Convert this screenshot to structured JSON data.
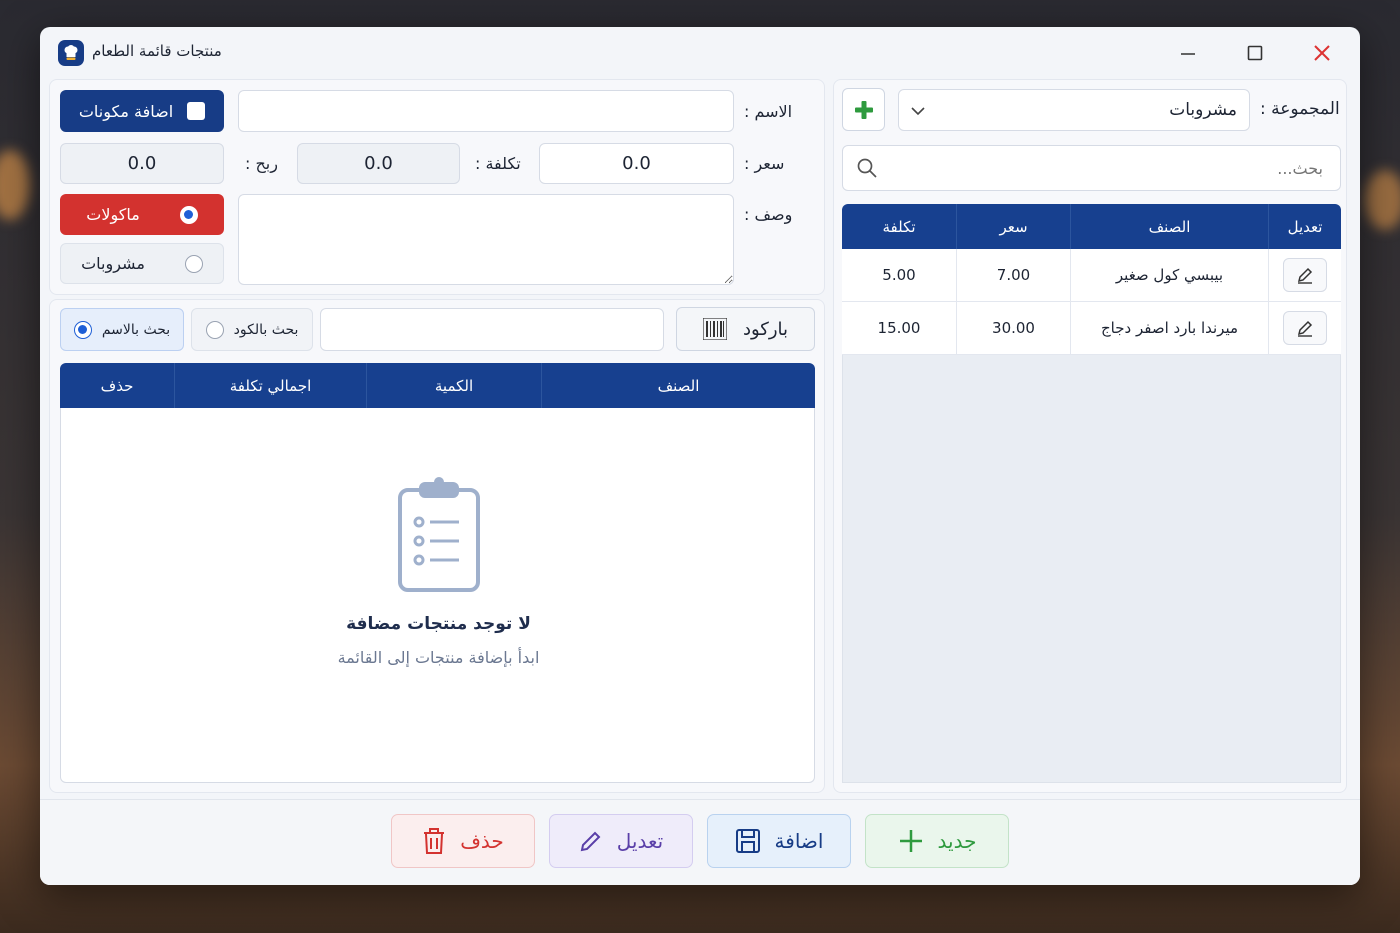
{
  "window": {
    "title": "منتجات قائمة الطعام"
  },
  "group": {
    "label": "المجموعة :",
    "selected": "مشروبات"
  },
  "search": {
    "placeholder": "بحث..."
  },
  "products_table": {
    "headers": [
      "تعديل",
      "الصنف",
      "سعر",
      "تكلفة"
    ],
    "rows": [
      {
        "name": "بيبسي كول صغير",
        "price": "7.00",
        "cost": "5.00"
      },
      {
        "name": "ميرندا بارد اصفر دجاج",
        "price": "30.00",
        "cost": "15.00"
      }
    ]
  },
  "form": {
    "name_label": "الاسم :",
    "name_value": "",
    "add_ingredients_label": "اضافة مكونات",
    "price_label": "سعر :",
    "price_value": "0.0",
    "cost_label": "تكلفة :",
    "cost_value": "0.0",
    "profit_label": "ربح :",
    "profit_value": "0.0",
    "desc_label": "وصف :",
    "desc_value": "",
    "type_food": "ماكولات",
    "type_drinks": "مشروبات"
  },
  "ingredients": {
    "barcode_label": "باركود",
    "search_code_label": "بحث بالكود",
    "search_name_label": "بحث بالاسم",
    "search_value": "",
    "headers": [
      "الصنف",
      "الكمية",
      "اجمالي تكلفة",
      "حذف"
    ],
    "empty_title": "لا توجد منتجات مضافة",
    "empty_subtitle": "ابدأ بإضافة منتجات إلى القائمة"
  },
  "actions": {
    "delete": "حذف",
    "edit": "تعديل",
    "add": "اضافة",
    "new": "جديد"
  },
  "colors": {
    "header_blue": "#17408f",
    "food_red": "#d3322f",
    "add_green": "#2e9a3e"
  }
}
